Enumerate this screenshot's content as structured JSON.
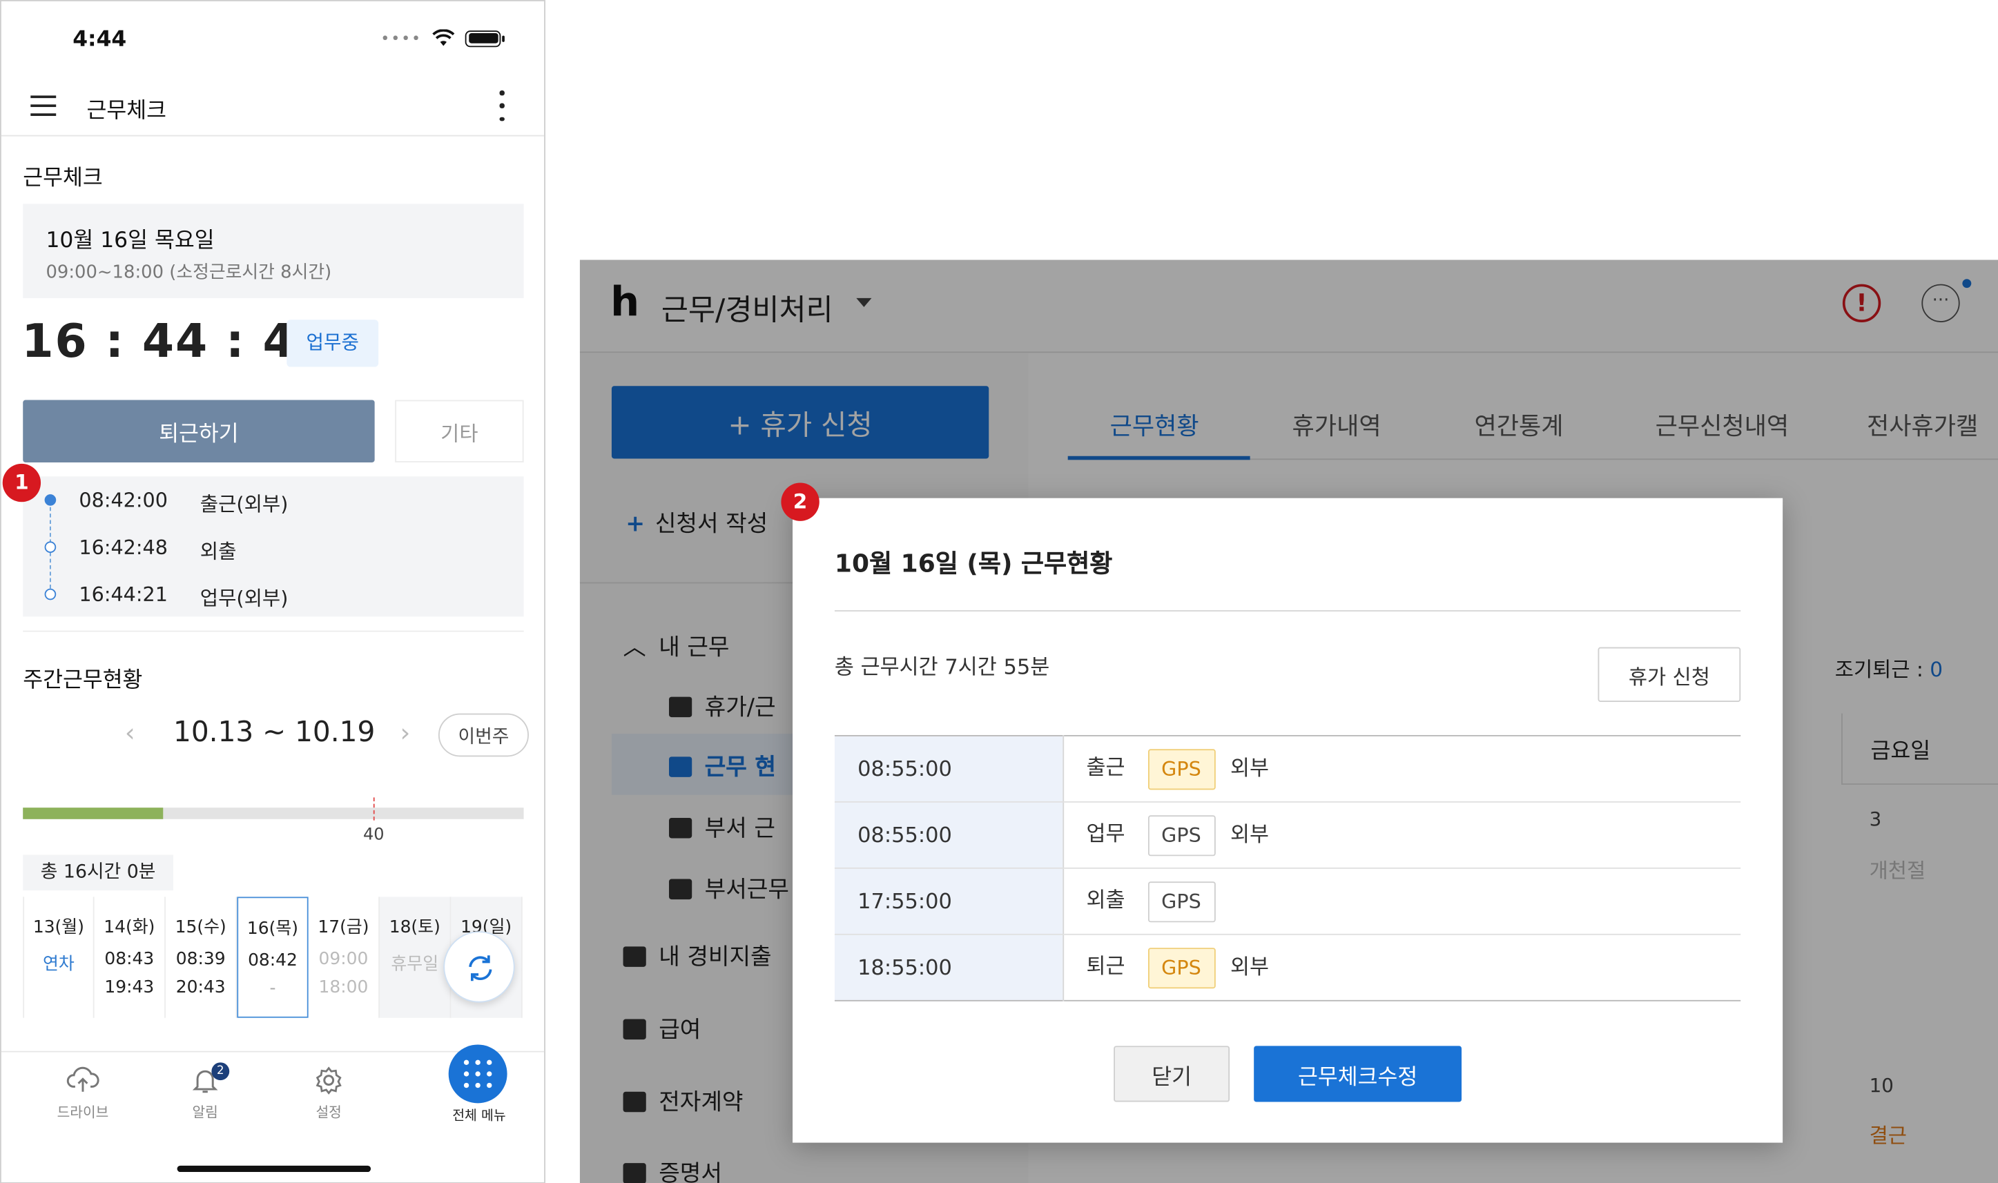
{
  "phone": {
    "status_time": "4:44",
    "app_title": "근무체크",
    "section_title": "근무체크",
    "date_card": {
      "date": "10월 16일 목요일",
      "schedule": "09:00~18:00 (소정근로시간 8시간)"
    },
    "clock": "16 : 44 : 46",
    "status_badge": "업무중",
    "leave_button": "퇴근하기",
    "etc_button": "기타",
    "logs": [
      {
        "time": "08:42:00",
        "type": "출근(외부)"
      },
      {
        "time": "16:42:48",
        "type": "외출"
      },
      {
        "time": "16:44:21",
        "type": "업무(외부)"
      }
    ],
    "weekly_title": "주간근무현황",
    "week_range": "10.13 ~ 10.19",
    "this_week_button": "이번주",
    "progress_fraction": 0.28,
    "progress_mark_label": "40",
    "total_hours": "총 16시간 0분",
    "days": [
      {
        "head": "13(월)",
        "v1": "연차",
        "v2": ""
      },
      {
        "head": "14(화)",
        "v1": "08:43",
        "v2": "19:43"
      },
      {
        "head": "15(수)",
        "v1": "08:39",
        "v2": "20:43"
      },
      {
        "head": "16(목)",
        "v1": "08:42",
        "v2": "-"
      },
      {
        "head": "17(금)",
        "v1": "09:00",
        "v2": "18:00"
      },
      {
        "head": "18(토)",
        "v1": "휴무일",
        "v2": ""
      },
      {
        "head": "19(일)",
        "v1": "",
        "v2": ""
      }
    ],
    "tabs": {
      "drive": "드라이브",
      "alerts": "알림",
      "settings": "설정",
      "all_menu": "전체 메뉴"
    },
    "alert_count": "2"
  },
  "badges": {
    "one": "1",
    "two": "2"
  },
  "desktop": {
    "logo": "h",
    "title": "근무/경비처리",
    "alert_symbol": "!",
    "more_symbol": "···",
    "leave_apply_button": "+ 휴가 신청",
    "new_form": "신청서 작성",
    "my_work": "내 근무",
    "sidebar_items": [
      "휴가/근",
      "근무 현",
      "부서 근",
      "부서근무"
    ],
    "my_expense": "내 경비지출",
    "salary": "급여",
    "e_contract": "전자계약",
    "certificate": "증명서",
    "tabs": [
      "근무현황",
      "휴가내역",
      "연간통계",
      "근무신청내역",
      "전사휴가캘"
    ],
    "early_leave_label": "조기퇴근 : ",
    "early_leave_value": "0",
    "cal_head": "금요일",
    "cal_cells": [
      {
        "num": "3",
        "txt": "개천절"
      },
      {
        "num": "10",
        "txt": "결근"
      }
    ]
  },
  "modal": {
    "title": "10월 16일 (목) 근무현황",
    "total": "총 근무시간 7시간 55분",
    "apply_button": "휴가 신청",
    "rows": [
      {
        "time": "08:55:00",
        "type": "출근",
        "gps": "GPS",
        "place": "외부"
      },
      {
        "time": "08:55:00",
        "type": "업무",
        "gps": "GPS",
        "place": "외부"
      },
      {
        "time": "17:55:00",
        "type": "외출",
        "gps": "GPS",
        "place": ""
      },
      {
        "time": "18:55:00",
        "type": "퇴근",
        "gps": "GPS",
        "place": "외부"
      }
    ],
    "close_button": "닫기",
    "edit_button": "근무체크수정"
  }
}
